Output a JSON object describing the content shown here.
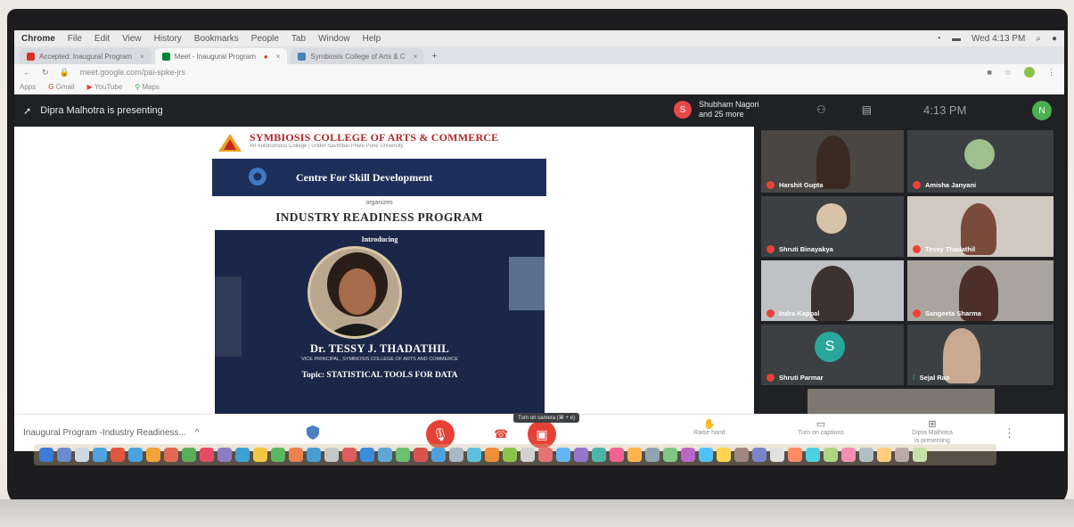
{
  "menubar": {
    "app": "Chrome",
    "items": [
      "File",
      "Edit",
      "View",
      "History",
      "Bookmarks",
      "People",
      "Tab",
      "Window",
      "Help"
    ],
    "clock": "Wed 4:13 PM"
  },
  "tabs": [
    {
      "label": "Accepted: Inaugural Program",
      "color": "#d93025"
    },
    {
      "label": "Meet - Inaugural Program",
      "color": "#00832d",
      "active": true
    },
    {
      "label": "Symbiosis College of Arts & C",
      "color": "#4a7fc1"
    }
  ],
  "address": {
    "url": "meet.google.com/pai-spke-jrs"
  },
  "bookmarks": [
    "Apps",
    "Gmail",
    "YouTube",
    "Maps"
  ],
  "meet": {
    "presenting": "Dipra Malhotra is presenting",
    "participants_line1": "Shubham Nagori",
    "participants_line2": "and 25 more",
    "avatar_letter": "S",
    "time": "4:13 PM",
    "self_letter": "N"
  },
  "slide": {
    "college_name": "SYMBIOSIS COLLEGE OF ARTS & COMMERCE",
    "college_sub": "An Autonomous College | Under Savitribai Phule Pune University",
    "centre": "Centre For Skill Development",
    "organizes": "organizes",
    "program": "INDUSTRY READINESS PROGRAM",
    "introducing": "Introducing",
    "speaker": "Dr. TESSY J. THADATHIL",
    "role": "VICE PRINCIPAL, SYMBIOSIS COLLEGE OF ARTS AND COMMERCE",
    "topic": "Topic: STATISTICAL TOOLS FOR DATA"
  },
  "participants": [
    {
      "name": "Harshit Gupta"
    },
    {
      "name": "Amisha Janyani"
    },
    {
      "name": "Shruti Binayakya"
    },
    {
      "name": "Tessy Thadathil"
    },
    {
      "name": "Indra Kappal"
    },
    {
      "name": "Sangeeta Sharma"
    },
    {
      "name": "Shruti Parmar",
      "letter": "S"
    },
    {
      "name": "Sejal Rao"
    }
  ],
  "bottombar": {
    "meeting_title": "Inaugural Program -Industry Readiness...",
    "caret": "^",
    "tooltip": "Turn on camera (⌘ + e)",
    "raise_hand": "Raise hand",
    "captions": "Turn on captions",
    "presenting_line1": "Dipra Malhotra",
    "presenting_line2": "is presenting"
  },
  "colors": {
    "meet_dark": "#202124",
    "red": "#e44236",
    "slide_navy": "#1b2748"
  }
}
